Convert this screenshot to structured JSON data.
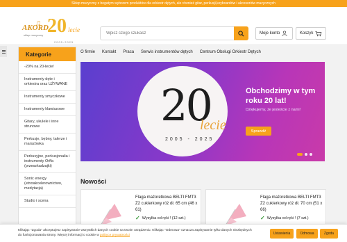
{
  "topbar": {
    "text": "Sklep muzyczny z bogatym wyborem produktów dla orkiestr dętych, ale również gitar, perkusji,keyboardów i akcesoriów muzycznych"
  },
  "logo": {
    "brand": "AKORD",
    "tagline": "sklep muzyczny",
    "anniversary": "20",
    "lecie": "lecie",
    "years": "2005-2025"
  },
  "search": {
    "placeholder": "Wpisz czego szukasz",
    "value": ""
  },
  "header": {
    "account_label": "Moje konto",
    "cart_label": "Koszyk"
  },
  "sidebar": {
    "title": "Kategorie",
    "items": [
      {
        "label": "-20% na 20-lecie!"
      },
      {
        "label": "Instrumenty dęte i orkiestra oraz UŻYWANE"
      },
      {
        "label": "Instrumenty smyczkowe"
      },
      {
        "label": "Instrumenty klawiszowe"
      },
      {
        "label": "Gitary, ukulele i inne strunowe"
      },
      {
        "label": "Perkusje, bębny, talerze i marszówka"
      },
      {
        "label": "Perkusyjne, perkusjonalia i instrumenty Orffa (przeszkadzajki)"
      },
      {
        "label": "Sonic energy (etnoakcelerownictwo, medytacja)"
      },
      {
        "label": "Studio i scena"
      }
    ]
  },
  "nav": {
    "items": [
      {
        "label": "O firmie"
      },
      {
        "label": "Kontakt"
      },
      {
        "label": "Praca"
      },
      {
        "label": "Serwis instrumentów dętych"
      },
      {
        "label": "Centrum Obsługi Orkiestr Dętych"
      }
    ]
  },
  "banner": {
    "big_number": "20",
    "lecie": "lecie",
    "years": "2005 - 2025",
    "title": "Obchodzimy w tym roku 20 lat!",
    "subtitle": "Dziękujemy, że jesteście z nami!",
    "button_label": "Sprawdź"
  },
  "new_section": {
    "title": "Nowości"
  },
  "products": [
    {
      "name": "Flaga mażoretkowa BELTI FMT3 Z2 cukierkowy róż dł. 65 cm (46 x 61)",
      "availability": "Wysyłka od ręki ! (12 szt.)"
    },
    {
      "name": "Flaga mażoretkowa BELTI FMT3 Z2 cukierkowy róż dł. 70 cm (51 x 66)",
      "availability": "Wysyłka od ręki ! (7 szt.)"
    }
  ],
  "cookie": {
    "text": "Klikając \"Zgoda\" akceptujesz zapisywanie wszystkich danych cookie na twoim urządzeniu. Klikając \"Odmowa\" oznacza zapisywanie tylko danych niezbędnych do funkcjonowania strony. Więcej informacji o cookie w",
    "link": "polityce prywatności",
    "settings_label": "Ustawienia",
    "reject_label": "Odmowa",
    "accept_label": "Zgoda"
  },
  "colors": {
    "accent": "#f7a21b",
    "banner_start": "#5a3fcf",
    "banner_end": "#c93aa9",
    "success": "#3a9a3a"
  }
}
